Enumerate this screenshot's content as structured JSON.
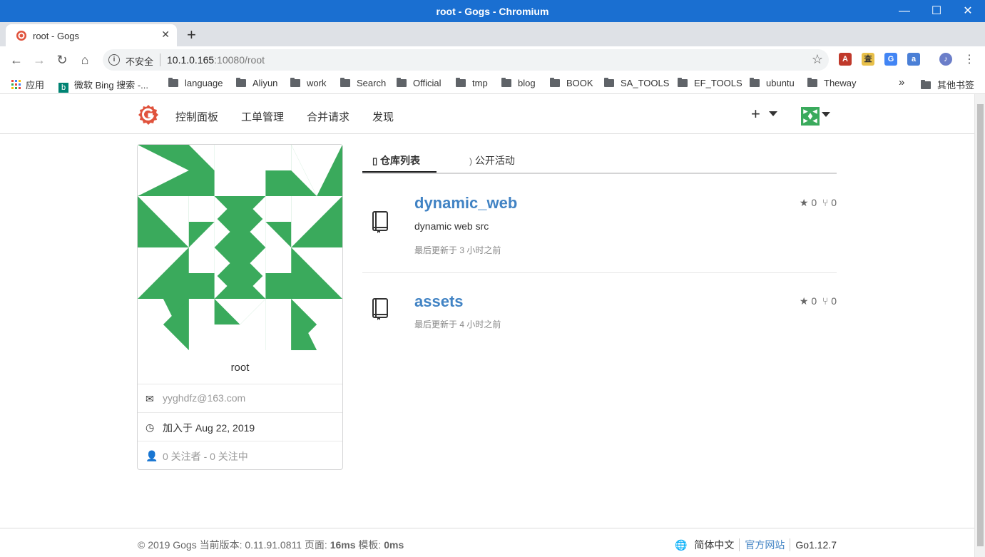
{
  "window": {
    "title": "root - Gogs - Chromium",
    "minimize": "—",
    "maximize": "☐",
    "close": "✕"
  },
  "browser": {
    "tab": {
      "title": "root - Gogs",
      "close": "✕"
    },
    "new_tab": "+",
    "omnibox": {
      "security": "不安全",
      "url_host": "10.1.0.165",
      "url_rest": ":10080/root"
    },
    "extensions": [
      {
        "name": "a-extension-icon",
        "label": "A",
        "color": "#c0392b"
      },
      {
        "name": "dict-extension-icon",
        "label": "査",
        "color": "#e8c04a"
      },
      {
        "name": "translate-extension-icon",
        "label": "G",
        "color": "#4285f4"
      },
      {
        "name": "translate2-extension-icon",
        "label": "a",
        "color": "#4a7fd6"
      },
      {
        "name": "profile-icon",
        "label": "♪",
        "color": "#6b7ec9"
      }
    ],
    "bookmarks": {
      "apps": "应用",
      "bing": "微软 Bing 搜索 -...",
      "folders": [
        "language",
        "Aliyun",
        "work",
        "Search",
        "Official",
        "tmp",
        "blog",
        "BOOK",
        "SA_TOOLS",
        "EF_TOOLS",
        "ubuntu",
        "Theway"
      ],
      "overflow": "»",
      "other": "其他书签"
    }
  },
  "navbar": {
    "items": [
      "控制面板",
      "工单管理",
      "合并请求",
      "发现"
    ],
    "plus": "+"
  },
  "profile": {
    "username": "root",
    "email": "yyghdfz@163.com",
    "joined": "加入于 Aug 22, 2019",
    "follow": "0 关注者 - 0 关注中"
  },
  "tabs": {
    "repos": "仓库列表",
    "activity": "公开活动"
  },
  "repos": [
    {
      "name": "dynamic_web",
      "description": "dynamic web src",
      "updated": "最后更新于 3 小时之前",
      "stars": "0",
      "forks": "0"
    },
    {
      "name": "assets",
      "description": "",
      "updated": "最后更新于 4 小时之前",
      "stars": "0",
      "forks": "0"
    }
  ],
  "footer": {
    "copyright": "© 2019 Gogs 当前版本: 0.11.91.0811 页面: ",
    "page_time": "16ms",
    "template_label": " 模板: ",
    "template_time": "0ms",
    "language": "简体中文",
    "website": "官方网站",
    "go_version": "Go1.12.7"
  },
  "colors": {
    "title_bar": "#1a6fd1",
    "link": "#4183c4",
    "avatar_green": "#3aaa5c",
    "gogs_logo": "#e0533d"
  }
}
